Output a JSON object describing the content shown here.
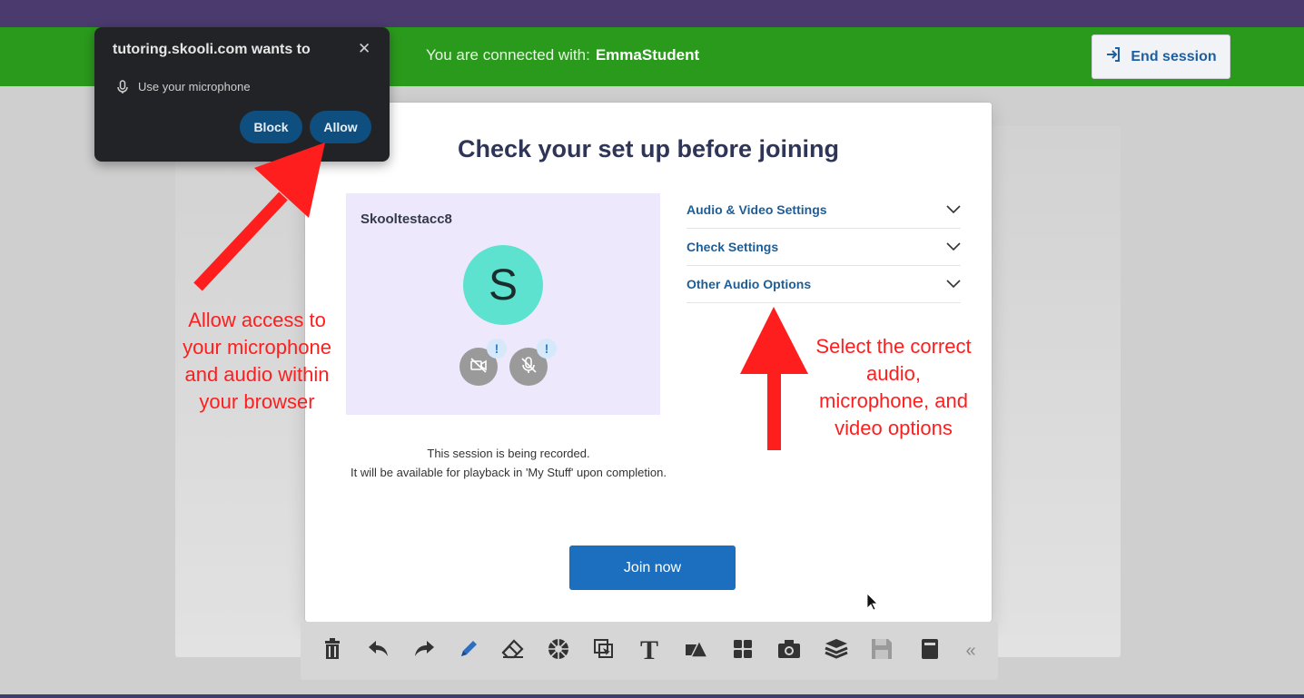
{
  "header": {
    "connected_label": "You are connected with:",
    "connected_user": "EmmaStudent",
    "end_session_label": "End session"
  },
  "permission_prompt": {
    "title": "tutoring.skooli.com wants to",
    "close_glyph": "✕",
    "request_text": "Use your microphone",
    "block_label": "Block",
    "allow_label": "Allow"
  },
  "modal": {
    "title": "Check your set up before joining",
    "preview_name": "Skooltestacc8",
    "avatar_letter": "S",
    "badge_glyph": "!",
    "settings": [
      {
        "label": "Audio & Video Settings"
      },
      {
        "label": "Check Settings"
      },
      {
        "label": "Other Audio Options"
      }
    ],
    "recorded_line1": "This session is being recorded.",
    "recorded_line2": "It will be available for playback in 'My Stuff' upon completion.",
    "join_label": "Join now"
  },
  "annotations": {
    "left_lines": [
      "Allow access to",
      "your microphone",
      "and audio within",
      "your browser"
    ],
    "right_lines": [
      "Select the correct",
      "audio,",
      "microphone, and",
      "video options"
    ]
  },
  "toolbar": {
    "text_tool_glyph": "T",
    "collapse_glyph": "«"
  },
  "colors": {
    "top_bar": "#4b3a6e",
    "green_bar": "#2a9a1c",
    "accent_blue": "#1c6fbf",
    "annotation_red": "#ff1e1e"
  }
}
